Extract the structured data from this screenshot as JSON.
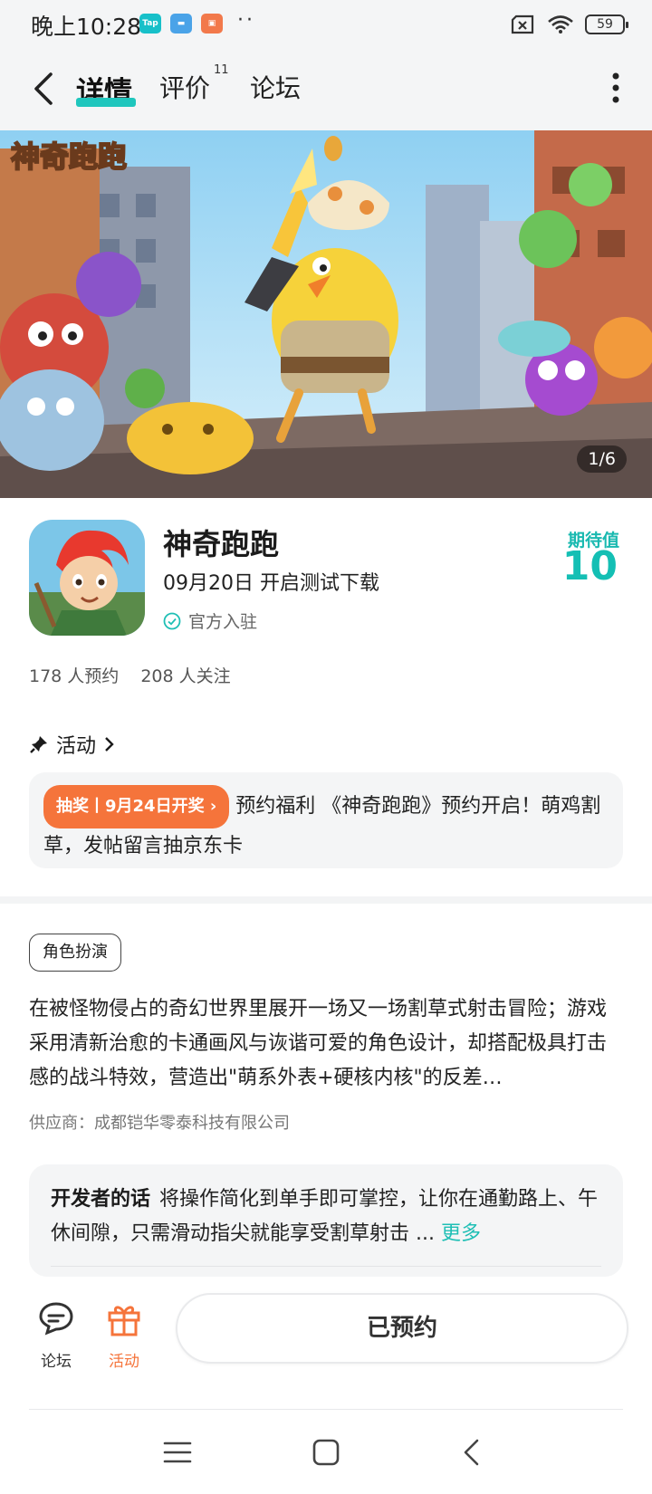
{
  "status_bar": {
    "time": "晚上10:28",
    "app_badges": [
      "TapTap",
      "card",
      "shop"
    ],
    "battery": "59"
  },
  "nav": {
    "tabs": [
      {
        "label": "详情",
        "active": true
      },
      {
        "label": "评价",
        "badge": "11"
      },
      {
        "label": "论坛"
      }
    ]
  },
  "banner": {
    "logo_text": "神奇跑跑",
    "counter": "1/6"
  },
  "game": {
    "title": "神奇跑跑",
    "date_text": "09月20日 开启测试下载",
    "official_label": "官方入驻",
    "rating_label": "期待值",
    "rating_value": "10",
    "reserve_count": "178 人预约",
    "follow_count": "208 人关注"
  },
  "activity": {
    "header": "活动",
    "tag": "抽奖丨9月24日开奖",
    "text": "预约福利 《神奇跑跑》预约开启！萌鸡割草，发帖留言抽京东卡"
  },
  "detail": {
    "genre": "角色扮演",
    "description": "在被怪物侵占的奇幻世界里展开一场又一场割草式射击冒险；游戏采用清新治愈的卡通画风与诙谐可爱的角色设计，却搭配极具打击感的战斗特效，营造出\"萌系外表+硬核内核\"的反差…",
    "supplier": "供应商：成都铠华零泰科技有限公司"
  },
  "developer": {
    "label": "开发者的话",
    "text": "将操作简化到单手即可掌控，让你在通勤路上、午休间隙，只需滑动指尖就能享受割草射击 ...",
    "more": "更多"
  },
  "actions": {
    "forum": "论坛",
    "activity": "活动",
    "reserved": "已预约"
  },
  "colors": {
    "accent": "#1fc6bd",
    "orange": "#f5743b"
  }
}
